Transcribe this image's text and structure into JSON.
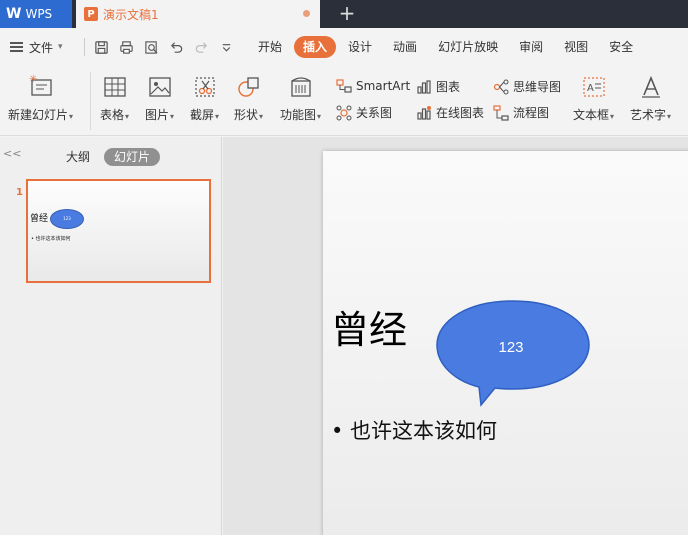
{
  "titlebar": {
    "app_tab": "WPS",
    "doc_tab": "演示文稿1",
    "add_tab": "+"
  },
  "menubar": {
    "file_label": "文件",
    "tabs": [
      {
        "label": "开始",
        "active": false
      },
      {
        "label": "插入",
        "active": true
      },
      {
        "label": "设计",
        "active": false
      },
      {
        "label": "动画",
        "active": false
      },
      {
        "label": "幻灯片放映",
        "active": false
      },
      {
        "label": "审阅",
        "active": false
      },
      {
        "label": "视图",
        "active": false
      },
      {
        "label": "安全",
        "active": false
      }
    ]
  },
  "ribbon": {
    "new_slide": "新建幻灯片",
    "table": "表格",
    "picture": "图片",
    "screenshot": "截屏",
    "shape": "形状",
    "function_chart": "功能图",
    "smartart": "SmartArt",
    "relation_chart": "关系图",
    "chart": "图表",
    "online_chart": "在线图表",
    "mindmap": "思维导图",
    "flowchart": "流程图",
    "textbox": "文本框",
    "wordart": "艺术字"
  },
  "leftpanel": {
    "collapse": "<<",
    "outline_tab": "大纲",
    "slides_tab": "幻灯片",
    "slide_number": "1",
    "thumb_title": "曾经",
    "thumb_bubble": "123",
    "thumb_bullet": "• 也许这本该如何"
  },
  "slide": {
    "title": "曾经",
    "bubble_text": "123",
    "bullet": "• 也许这本该如何"
  },
  "colors": {
    "accent": "#e8703a",
    "bubble": "#4a7be0",
    "titlebar": "#2b2f3a"
  }
}
